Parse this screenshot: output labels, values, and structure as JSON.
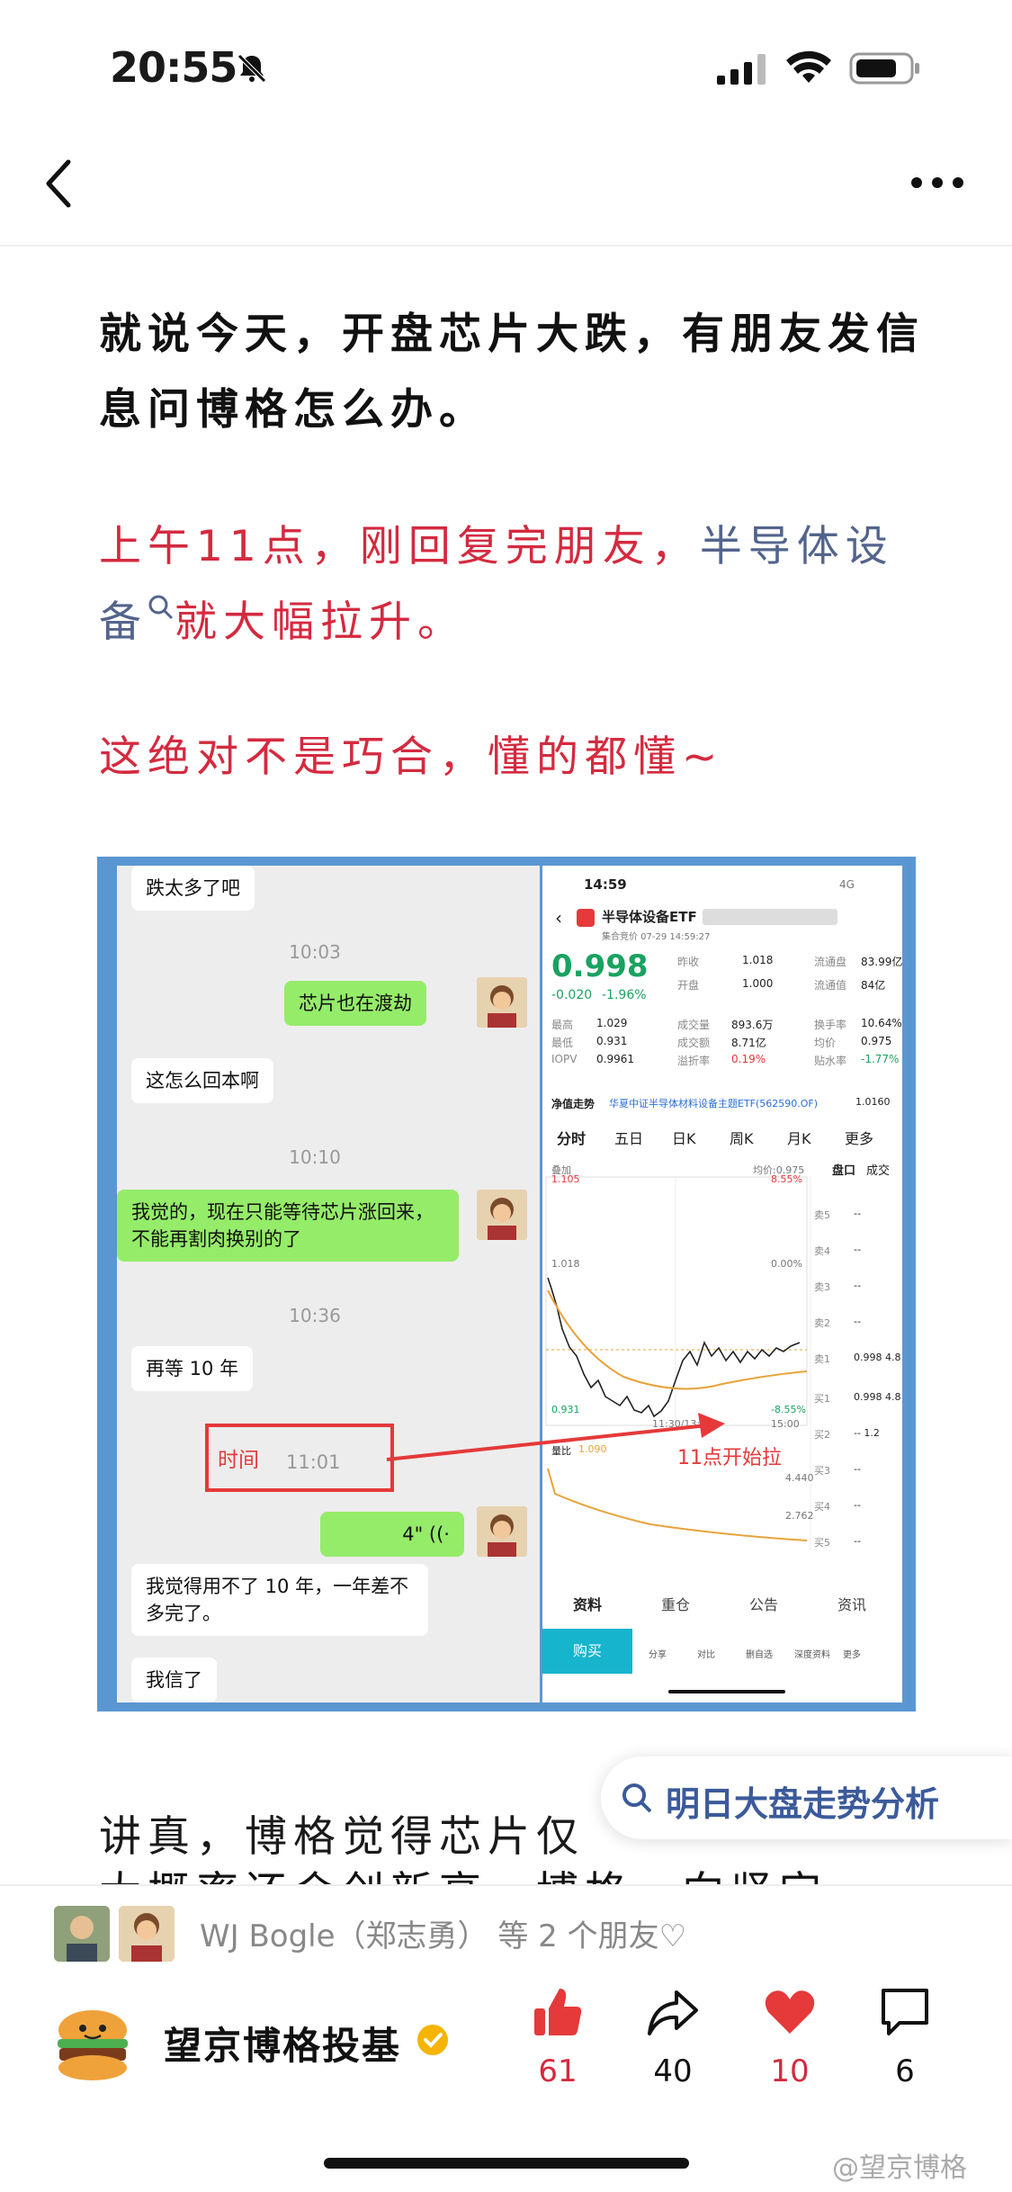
{
  "status_bar": {
    "time": "20:55",
    "icons": [
      "bell-mute-icon",
      "signal-icon",
      "wifi-icon",
      "battery-icon"
    ]
  },
  "nav": {
    "back_icon": "chevron-left-icon",
    "more_icon": "more-dots-icon"
  },
  "article": {
    "p1": "就说今天，开盘芯片大跌，有朋友发信息问博格怎么办。",
    "p2_prefix": "上午11点，刚回复完朋友，",
    "p2_link": "半导体设备",
    "p2_suffix": "就大幅拉升。",
    "p3": "这绝对不是巧合，懂的都懂~",
    "p4_visible": "讲真，博格觉得芯片仅",
    "p5_partial": "大概率还会创新高，博格一向坚定"
  },
  "screenshot": {
    "chat": {
      "m1": "跌太多了吧",
      "t1": "10:03",
      "m2": "芯片也在渡劫",
      "m3": "这怎么回本啊",
      "t2": "10:10",
      "m4": "我觉的，现在只能等待芯片涨回来，不能再割肉换别的了",
      "t3": "10:36",
      "m5": "再等 10 年",
      "time_label": "时间",
      "t4": "11:01",
      "voice": "4\"",
      "m6": "我觉得用不了 10 年，一年差不多完了。",
      "m7": "我信了"
    },
    "stock": {
      "time": "14:59",
      "net": "4G",
      "name": "半导体设备ETF",
      "sub": "集合竞价 07-29 14:59:27",
      "price": "0.998",
      "change": "-0.020",
      "pct": "-1.96%",
      "r1": [
        "昨收",
        "1.018",
        "流通盘",
        "83.99亿"
      ],
      "r2": [
        "开盘",
        "1.000",
        "流通值",
        "84亿"
      ],
      "r3": [
        "最高",
        "1.029",
        "成交量",
        "893.6万",
        "换手率",
        "10.64%"
      ],
      "r4": [
        "最低",
        "0.931",
        "成交额",
        "8.71亿",
        "均价",
        "0.975"
      ],
      "r5": [
        "IOPV",
        "0.9961",
        "溢折率",
        "0.19%",
        "贴水率",
        "-1.77%"
      ],
      "index_label": "净值走势",
      "index_name": "华夏中证半导体材料设备主题ETF(562590.OF)",
      "index_val": "1.0160",
      "tabs": [
        "分时",
        "五日",
        "日K",
        "周K",
        "月K",
        "更多"
      ],
      "overlay": "叠加",
      "avg": "均价:0.975",
      "side_tabs": [
        "盘口",
        "成交"
      ],
      "ymax": "1.105",
      "ymax_pct": "8.55%",
      "ymid": "1.018",
      "ymid_pct": "0.00%",
      "ymin": "0.931",
      "ymin_pct": "-8.55%",
      "xmid": "11:30/13:00",
      "xend": "15:00",
      "vol_label": "量比",
      "vol_val": "1.090",
      "vol_v1": "4.440",
      "vol_v2": "2.762",
      "annot": "11点开始拉",
      "book": [
        "卖5",
        "卖4",
        "卖3",
        "卖2",
        "卖1",
        "买1",
        "买2",
        "买3",
        "买4",
        "买5"
      ],
      "book_vals": [
        "--",
        "--",
        "--",
        "--",
        "0.998 4.8",
        "0.998 4.8",
        "-- 1.2",
        "--",
        "--",
        "--"
      ],
      "bottom_tabs": [
        "资料",
        "重仓",
        "公告",
        "资讯"
      ],
      "buy": "购买",
      "actions": [
        "分享",
        "对比",
        "删自选",
        "深度资料",
        "更多"
      ]
    }
  },
  "floating_search": {
    "label": "明日大盘走势分析",
    "icon": "search-icon"
  },
  "likes_bar": {
    "text": "WJ Bogle（郑志勇） 等 2 个朋友♡"
  },
  "account": {
    "name": "望京博格投基",
    "badge": "verified-icon"
  },
  "actions": {
    "like_count": "61",
    "share_count": "40",
    "fav_count": "10",
    "comment_count": "6"
  },
  "watermark": "@望京博格",
  "colors": {
    "accent_red": "#d42a3f",
    "link_blue": "#53648c",
    "wechat_green": "#95ec69"
  }
}
